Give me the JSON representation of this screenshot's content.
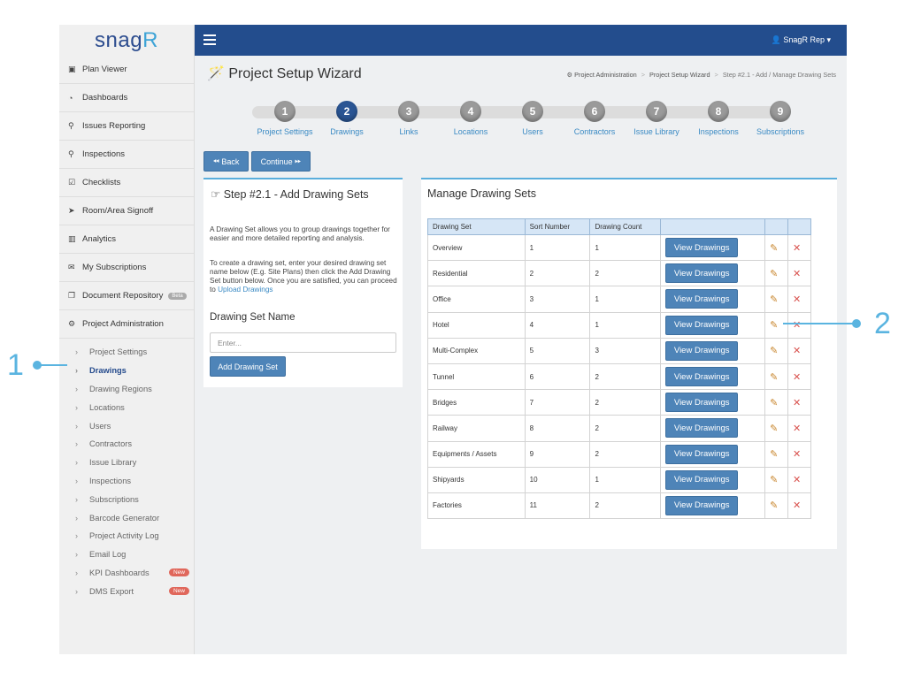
{
  "brand": {
    "logo_main": "snag",
    "logo_accent": "R"
  },
  "topbar": {
    "user": "SnagR Rep"
  },
  "sidebar": {
    "items": [
      {
        "label": "Plan Viewer",
        "icon": "image-icon",
        "glyph": "▣"
      },
      {
        "label": "Dashboards",
        "icon": "dashboard-icon",
        "glyph": "◔"
      },
      {
        "label": "Issues Reporting",
        "icon": "map-marker-icon",
        "glyph": "⚲"
      },
      {
        "label": "Inspections",
        "icon": "search-icon",
        "glyph": "⚲"
      },
      {
        "label": "Checklists",
        "icon": "checkbox-icon",
        "glyph": "☑"
      },
      {
        "label": "Room/Area Signoff",
        "icon": "send-icon",
        "glyph": "➤"
      },
      {
        "label": "Analytics",
        "icon": "bar-chart-icon",
        "glyph": "▥"
      },
      {
        "label": "My Subscriptions",
        "icon": "envelope-icon",
        "glyph": "✉"
      },
      {
        "label": "Document Repository",
        "icon": "documents-icon",
        "glyph": "❐",
        "badge": "Beta"
      },
      {
        "label": "Project Administration",
        "icon": "cogs-icon",
        "glyph": "⚙"
      }
    ],
    "sub_items": [
      {
        "label": "Project Settings"
      },
      {
        "label": "Drawings",
        "active": true
      },
      {
        "label": "Drawing Regions"
      },
      {
        "label": "Locations"
      },
      {
        "label": "Users"
      },
      {
        "label": "Contractors"
      },
      {
        "label": "Issue Library"
      },
      {
        "label": "Inspections"
      },
      {
        "label": "Subscriptions"
      },
      {
        "label": "Barcode Generator"
      },
      {
        "label": "Project Activity Log"
      },
      {
        "label": "Email Log"
      },
      {
        "label": "KPI Dashboards",
        "badge": "New"
      },
      {
        "label": "DMS Export",
        "badge": "New"
      }
    ]
  },
  "header": {
    "title": "Project Setup Wizard",
    "breadcrumb": [
      "Project Administration",
      "Project Setup Wizard",
      "Step #2.1 - Add / Manage Drawing Sets"
    ]
  },
  "wizard": {
    "steps": [
      {
        "num": "1",
        "label": "Project Settings"
      },
      {
        "num": "2",
        "label": "Drawings",
        "active": true
      },
      {
        "num": "3",
        "label": "Links"
      },
      {
        "num": "4",
        "label": "Locations"
      },
      {
        "num": "5",
        "label": "Users"
      },
      {
        "num": "6",
        "label": "Contractors"
      },
      {
        "num": "7",
        "label": "Issue Library"
      },
      {
        "num": "8",
        "label": "Inspections"
      },
      {
        "num": "9",
        "label": "Subscriptions"
      }
    ],
    "back_label": "Back",
    "continue_label": "Continue"
  },
  "add_panel": {
    "title": "Step #2.1 - Add Drawing Sets",
    "desc1": "A Drawing Set allows you to group drawings together for easier and more detailed reporting and analysis.",
    "desc2": "To create a drawing set, enter your desired drawing set name below (E.g. Site Plans) then click the Add Drawing Set button below. Once you are satisfied, you can proceed to",
    "desc2_link": "Upload Drawings",
    "field_label": "Drawing Set Name",
    "field_placeholder": "Enter...",
    "field_value": "",
    "add_button": "Add Drawing Set"
  },
  "manage_panel": {
    "title": "Manage Drawing Sets",
    "columns": [
      "Drawing Set",
      "Sort Number",
      "Drawing Count",
      "",
      "",
      ""
    ],
    "view_label": "View Drawings",
    "rows": [
      {
        "name": "Overview",
        "sort": "1",
        "count": "1"
      },
      {
        "name": "Residential",
        "sort": "2",
        "count": "2"
      },
      {
        "name": "Office",
        "sort": "3",
        "count": "1"
      },
      {
        "name": "Hotel",
        "sort": "4",
        "count": "1"
      },
      {
        "name": "Multi-Complex",
        "sort": "5",
        "count": "3"
      },
      {
        "name": "Tunnel",
        "sort": "6",
        "count": "2"
      },
      {
        "name": "Bridges",
        "sort": "7",
        "count": "2"
      },
      {
        "name": "Railway",
        "sort": "8",
        "count": "2"
      },
      {
        "name": "Equipments / Assets",
        "sort": "9",
        "count": "2"
      },
      {
        "name": "Shipyards",
        "sort": "10",
        "count": "1"
      },
      {
        "name": "Factories",
        "sort": "11",
        "count": "2"
      }
    ]
  },
  "callouts": {
    "one": "1",
    "two": "2"
  },
  "colors": {
    "topbar": "#234d8d",
    "accent": "#5ab4e0",
    "button": "#4e84b8",
    "link": "#3a8ac4",
    "danger": "#d9534f"
  }
}
